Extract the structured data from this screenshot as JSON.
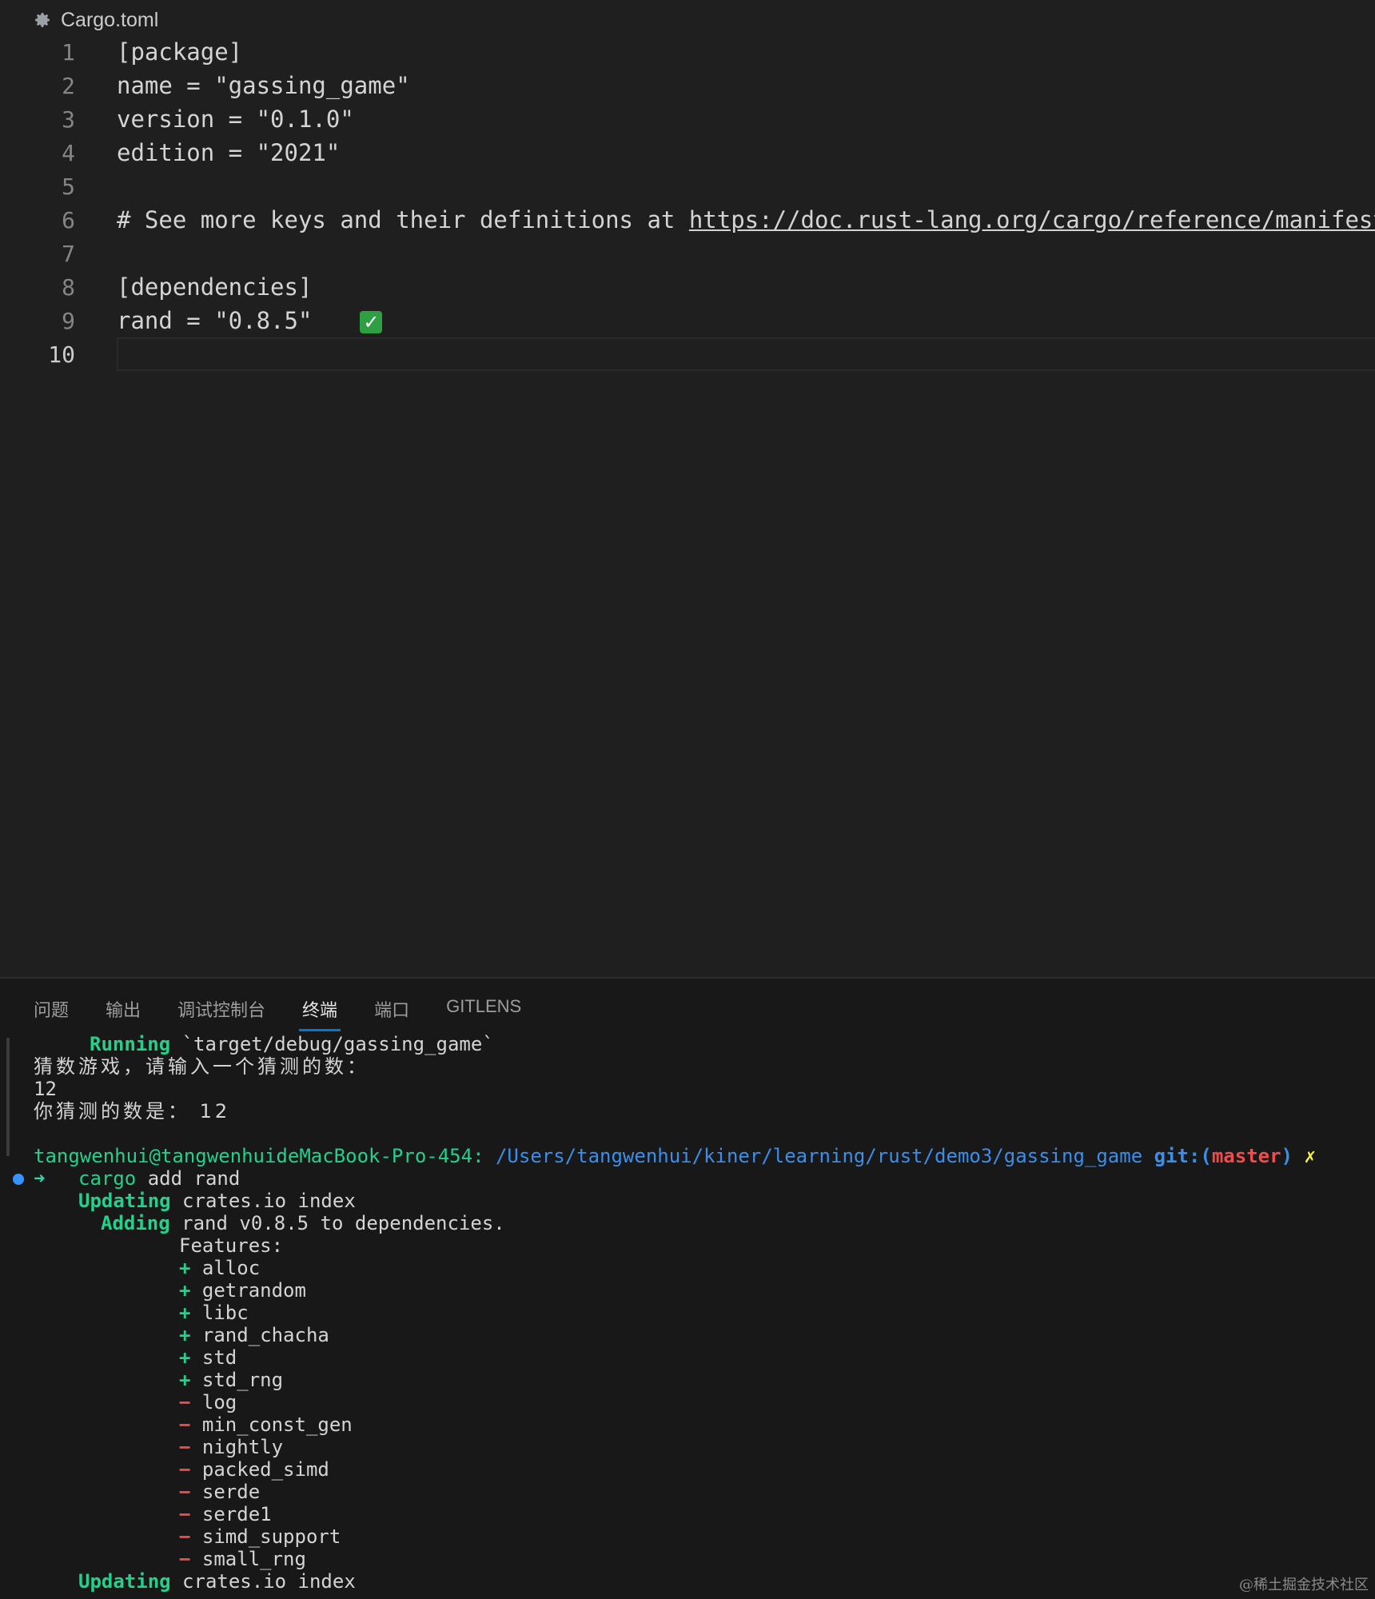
{
  "editor": {
    "file_name": "Cargo.toml",
    "file_icon": "gear-icon",
    "lines": [
      {
        "n": "1",
        "text": "[package]"
      },
      {
        "n": "2",
        "text": "name = \"gassing_game\""
      },
      {
        "n": "3",
        "text": "version = \"0.1.0\""
      },
      {
        "n": "4",
        "text": "edition = \"2021\""
      },
      {
        "n": "5",
        "text": ""
      },
      {
        "n": "6",
        "text": "# See more keys and their definitions at ",
        "link": "https://doc.rust-lang.org/cargo/reference/manifest.ht"
      },
      {
        "n": "7",
        "text": ""
      },
      {
        "n": "8",
        "text": "[dependencies]"
      },
      {
        "n": "9",
        "text": "rand = \"0.8.5\"",
        "check": "✓"
      },
      {
        "n": "10",
        "text": ""
      }
    ]
  },
  "panel": {
    "tabs": [
      "问题",
      "输出",
      "调试控制台",
      "终端",
      "端口",
      "GITLENS"
    ],
    "active_tab": "终端"
  },
  "terminal": {
    "running_label": "Running",
    "running_text": " `target/debug/gassing_game`",
    "prompt_msg": "猜数游戏，请输入一个猜测的数：",
    "input_value": "12",
    "guess_msg": "你猜测的数是： 12",
    "user_host": "tangwenhui@tangwenhuideMacBook-Pro-454:",
    "path": " /Users/tangwenhui/kiner/learning/rust/demo3/gassing_game",
    "git_label": " git:(",
    "branch": "master",
    "git_close": ")",
    "dirty_mark": " ✗",
    "arrow": "➜",
    "cmd_name": "cargo",
    "cmd_args": " add rand",
    "updating_label": "Updating",
    "updating_text": " crates.io index",
    "adding_label": "Adding",
    "adding_text": " rand v0.8.5 to dependencies.",
    "features_label": "Features:",
    "features_plus": [
      "alloc",
      "getrandom",
      "libc",
      "rand_chacha",
      "std",
      "std_rng"
    ],
    "features_minus": [
      "log",
      "min_const_gen",
      "nightly",
      "packed_simd",
      "serde",
      "serde1",
      "simd_support",
      "small_rng"
    ],
    "plus_sign": "+",
    "minus_sign": "−",
    "updating2_label": "Updating",
    "updating2_text": " crates.io index"
  },
  "watermark": "@稀土掘金技术社区",
  "colors": {
    "editor_bg": "#1f1f1f",
    "panel_bg": "#181818",
    "accent": "#0078d4",
    "green": "#23d18b",
    "red": "#f14c4c",
    "blue": "#3b8eea"
  }
}
